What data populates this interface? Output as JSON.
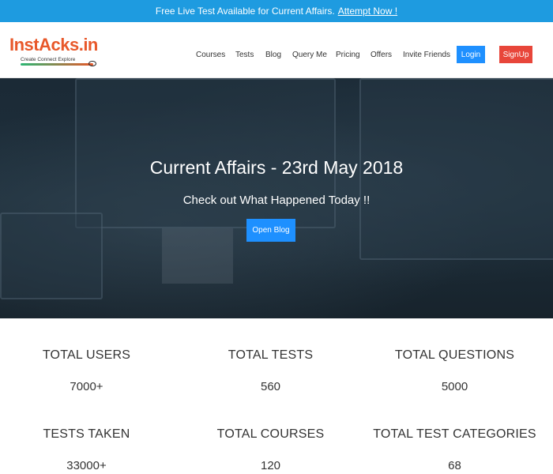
{
  "announcement": {
    "text": "Free Live Test Available for Current Affairs.",
    "link_text": "Attempt Now !"
  },
  "brand": {
    "name": "InstAcks.in",
    "tagline": "Create Connect Explore"
  },
  "nav": {
    "items": [
      "Courses",
      "Tests",
      "Blog",
      "Query Me",
      "Pricing",
      "Offers",
      "Invite Friends"
    ],
    "login_label": "Login",
    "signup_label": "SignUp"
  },
  "hero": {
    "title": "Current Affairs - 23rd May 2018",
    "subtitle": "Check out What Happened Today !!",
    "button_label": "Open Blog"
  },
  "stats": [
    {
      "label": "TOTAL USERS",
      "value": "7000+"
    },
    {
      "label": "TOTAL TESTS",
      "value": "560"
    },
    {
      "label": "TOTAL QUESTIONS",
      "value": "5000"
    },
    {
      "label": "TESTS TAKEN",
      "value": "33000+"
    },
    {
      "label": "TOTAL COURSES",
      "value": "120"
    },
    {
      "label": "TOTAL TEST CATEGORIES",
      "value": "68"
    }
  ],
  "colors": {
    "accent_blue": "#1e9be0",
    "button_blue": "#1e90ff",
    "signup_red": "#e8463a",
    "brand_orange": "#e8582a",
    "hero_bg": "#1e2f3b"
  }
}
